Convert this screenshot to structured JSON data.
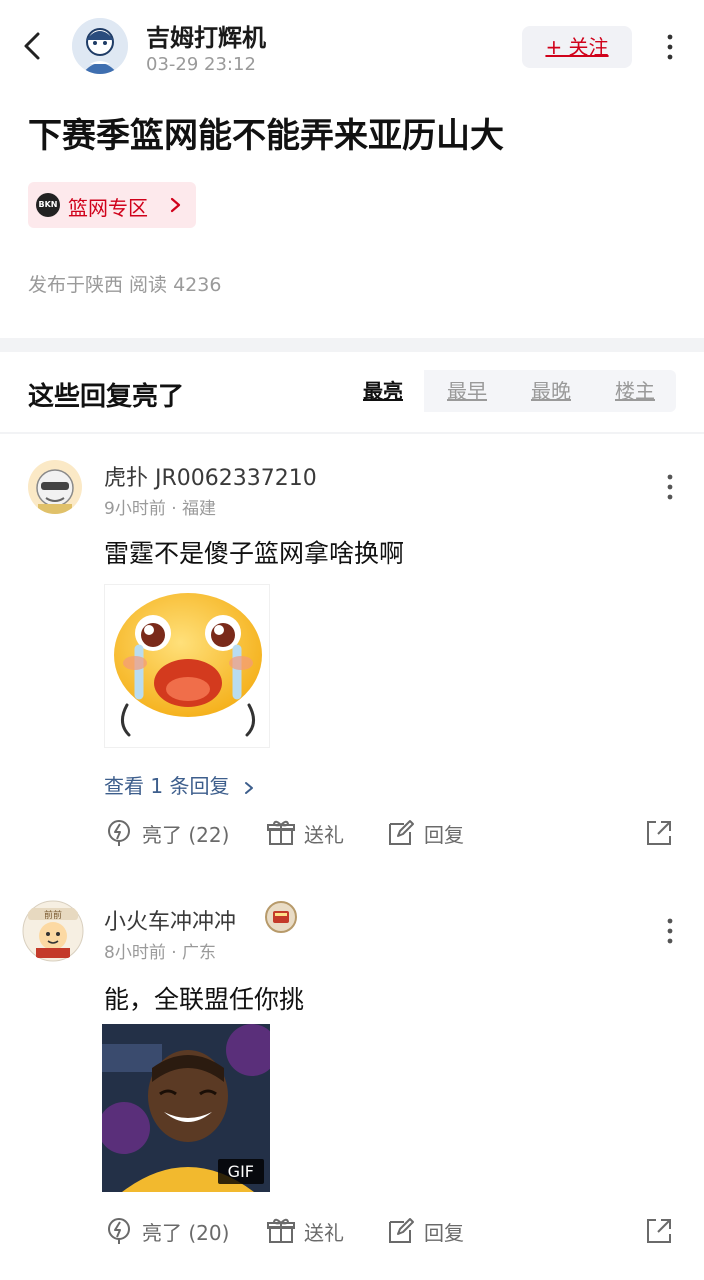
{
  "header": {
    "author_name": "吉姆打辉机",
    "post_time": "03-29 23:12",
    "follow_label": "+ 关注"
  },
  "post": {
    "title": "下赛季篮网能不能弄来亚历山大",
    "zone_logo_text": "BKN",
    "zone_label": "篮网专区",
    "meta": "发布于陕西  阅读 4236"
  },
  "replies_section": {
    "title": "这些回复亮了",
    "sort_tabs": [
      "最亮",
      "最早",
      "最晚",
      "楼主"
    ],
    "active_tab": "最亮"
  },
  "comments": [
    {
      "name": "虎扑 JR0062337210",
      "meta": "9小时前 · 福建",
      "text": "雷霆不是傻子篮网拿啥换啊",
      "reply_link": "查看 1 条回复",
      "like_label": "亮了 (22)",
      "gift_label": "送礼",
      "reply_label": "回复"
    },
    {
      "name": "小火车冲冲冲",
      "meta": "8小时前 · 广东",
      "text": "能，全联盟任你挑",
      "gif_label": "GIF",
      "like_label": "亮了 (20)",
      "gift_label": "送礼",
      "reply_label": "回复"
    }
  ],
  "colors": {
    "accent_red": "#d0021b",
    "link_blue": "#3d5e8c",
    "muted_gray": "#9a9a9a"
  },
  "icons": [
    "back-arrow-icon",
    "more-vertical-icon",
    "chevron-right-icon",
    "lightning-icon",
    "gift-icon",
    "edit-reply-icon",
    "share-icon"
  ]
}
